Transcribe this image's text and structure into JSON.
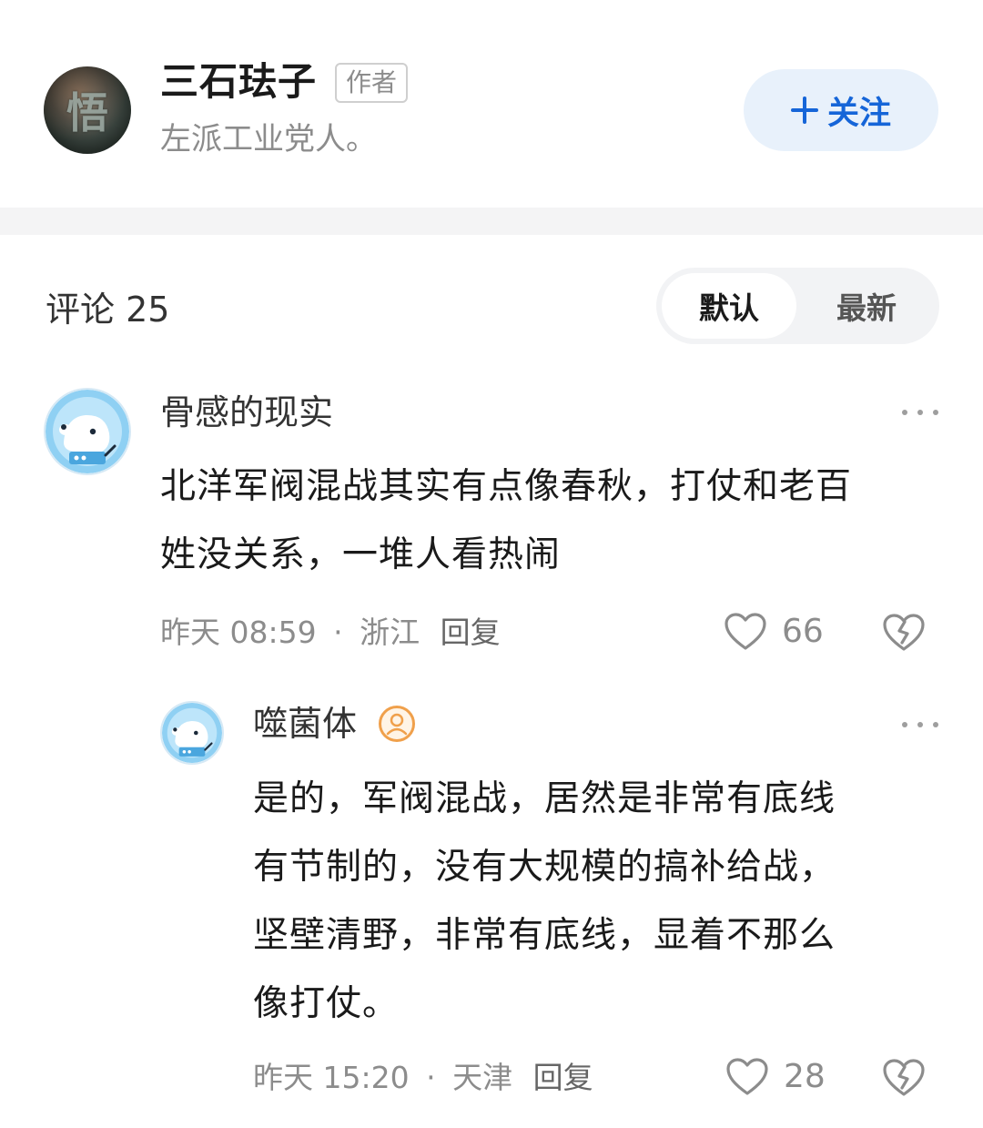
{
  "author": {
    "name": "三石珐子",
    "badge": "作者",
    "bio": "左派工业党人。",
    "avatar_glyph": "悟",
    "follow_label": "关注",
    "follow_icon": "plus-icon"
  },
  "comments_header": {
    "title": "评论 25",
    "sort_options": [
      "默认",
      "最新"
    ],
    "active_sort": "默认"
  },
  "comments": [
    {
      "user": "骨感的现实",
      "avatar_icon": "cartoon-dog-avatar",
      "lines": [
        "北洋军阀混战其实有点像春秋，打仗和老百",
        "姓没关系，一堆人看热闹"
      ],
      "time": "昨天 08:59",
      "separator": "·",
      "location": "浙江",
      "reply_label": "回复",
      "likes": "66",
      "more_icon": "more-icon",
      "like_icon": "heart-icon",
      "dislike_icon": "broken-heart-icon"
    }
  ],
  "replies": [
    {
      "user": "噬菌体",
      "avatar_icon": "cartoon-dog-avatar",
      "user_badge_icon": "user-badge-icon",
      "lines": [
        "是的，军阀混战，居然是非常有底线",
        "有节制的，没有大规模的搞补给战，",
        "坚壁清野，非常有底线，显着不那么",
        "像打仗。"
      ],
      "time": "昨天 15:20",
      "separator": "·",
      "location": "天津",
      "reply_label": "回复",
      "likes": "28",
      "more_icon": "more-icon",
      "like_icon": "heart-icon",
      "dislike_icon": "broken-heart-icon"
    }
  ],
  "colors": {
    "accent": "#1565d8",
    "follow_bg": "#e8f1fb",
    "muted_text": "#8c8c8c",
    "divider": "#f4f4f5"
  }
}
